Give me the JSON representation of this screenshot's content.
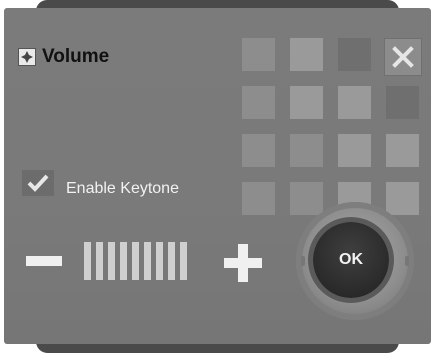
{
  "dialog": {
    "title": "Volume",
    "close_icon": "close-icon",
    "enable_keytone": {
      "label": "Enable Keytone",
      "checked": true
    },
    "volume": {
      "level_fraction": 1.0,
      "bars_filled": 9,
      "bars_total": 9
    },
    "ok_label": "OK",
    "colors": {
      "panel": "#7a7a7a",
      "text_dark": "#111111",
      "text_light": "#f2f2f2",
      "ok_button": "#2a2a2a"
    }
  }
}
